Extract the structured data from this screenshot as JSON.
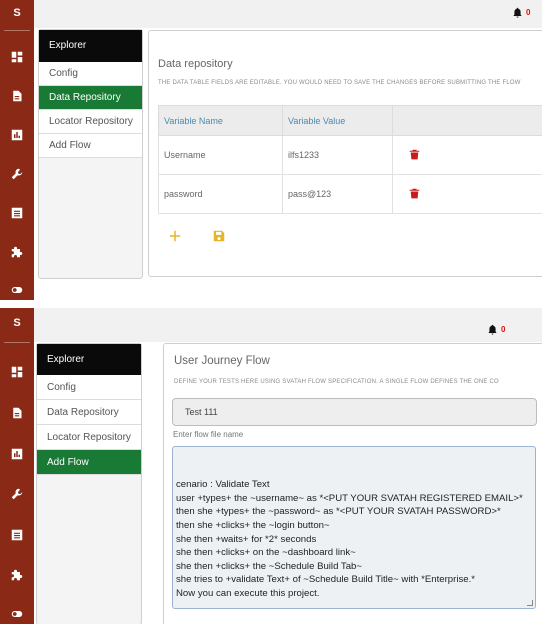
{
  "colors": {
    "rail": "#8a2a16",
    "active": "#197a35",
    "menu_head": "#0a0a0a",
    "header_blue": "#4a8ab3",
    "delete_red": "#c81b1b",
    "action_yellow": "#e5b52a",
    "badge_red": "#d11111"
  },
  "app": {
    "logo": "S",
    "notification_count": "0"
  },
  "rail_icons": [
    "dashboard-icon",
    "document-icon",
    "bar-chart-icon",
    "wrench-icon",
    "list-icon",
    "puzzle-icon",
    "toggle-icon"
  ],
  "top": {
    "menu": {
      "header": "Explorer",
      "items": [
        "Config",
        "Data Repository",
        "Locator Repository",
        "Add Flow"
      ],
      "active": "Data Repository"
    },
    "panel": {
      "title": "Data repository",
      "subtitle": "THE DATA TABLE FIELDS ARE EDITABLE. YOU WOULD NEED TO SAVE THE CHANGES BEFORE SUBMITTING THE FLOW",
      "columns": [
        "Variable Name",
        "Variable Value"
      ],
      "rows": [
        {
          "name": "Username",
          "value": "ilfs1233"
        },
        {
          "name": "password",
          "value": "pass@123"
        }
      ]
    }
  },
  "bottom": {
    "menu": {
      "header": "Explorer",
      "items": [
        "Config",
        "Data Repository",
        "Locator Repository",
        "Add Flow"
      ],
      "active": "Add Flow"
    },
    "panel": {
      "title": "User Journey Flow",
      "subtitle": "DEFINE YOUR TESTS HERE USING SVATAH FLOW SPECIFICATION. A SINGLE FLOW DEFINES THE ONE CO",
      "flow_name": "Test 111",
      "flow_name_label": "Enter flow file name",
      "flow_lines": [
        "cenario : Validate Text",
        "user +types+ the ~username~ as *<PUT YOUR SVATAH REGISTERED EMAIL>*",
        "then she +types+ the ~password~ as *<PUT YOUR SVATAH PASSWORD>*",
        "then she +clicks+ the ~login button~",
        "she then +waits+ for *2* seconds",
        "she then +clicks+ on the ~dashboard link~",
        "she then +clicks+ the ~Schedule Build Tab~",
        "she tries to +validate Text+ of ~Schedule Build Title~ with *Enterprise.*",
        "Now you can execute this project."
      ]
    }
  }
}
